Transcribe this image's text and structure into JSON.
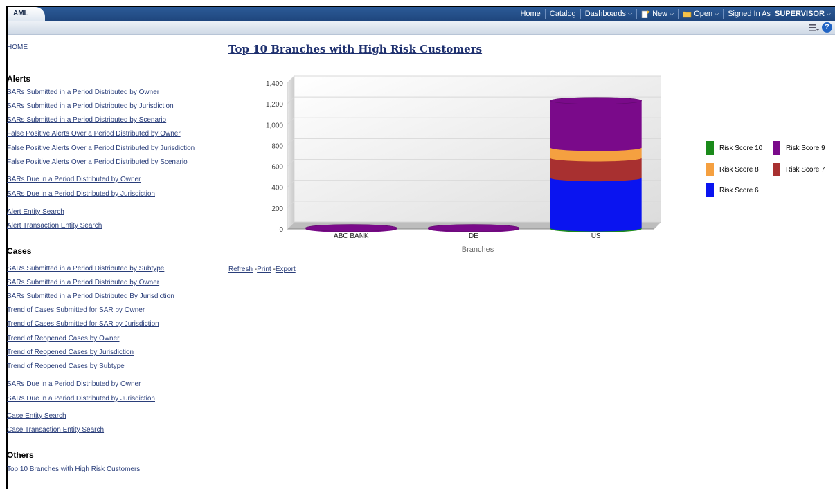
{
  "app": {
    "tab_label": "AML"
  },
  "nav": {
    "home": "Home",
    "catalog": "Catalog",
    "dashboards": "Dashboards",
    "new": "New",
    "open": "Open",
    "signed_in_prefix": "Signed In As",
    "user": "SUPERVISOR"
  },
  "sidebar": {
    "home_link": "HOME",
    "alerts_heading": "Alerts",
    "alerts": [
      "SARs Submitted in a Period Distributed by Owner",
      "SARs Submitted in a Period Distributed by Jurisdiction",
      "SARs Submitted in a Period Distributed by Scenario",
      "False Positive Alerts Over a Period Distributed by Owner",
      "False Positive Alerts Over a Period Distributed by Jurisdiction",
      "False Positive Alerts Over a Period Distributed by Scenario",
      "SARs Due in a Period Distributed by Owner",
      "SARs Due in a Period Distributed by Jurisdiction",
      "Alert Entity Search",
      "Alert Transaction Entity Search"
    ],
    "cases_heading": "Cases",
    "cases": [
      "SARs Submitted in a Period Distributed by Subtype",
      "SARs Submitted in a Period Distributed by Owner",
      "SARs Submitted in a Period Distributed By Jurisdiction",
      "Trend of Cases Submitted for SAR by Owner",
      "Trend of Cases Submitted for SAR by Jurisdiction",
      "Trend of Reopened Cases by Owner",
      "Trend of Reopened Cases by Jurisdiction",
      "Trend of Reopened Cases by Subtype",
      "SARs Due in a Period Distributed by Owner",
      "SARs Due in a Period Distributed by Jurisdiction",
      "Case Entity Search",
      "Case Transaction Entity Search"
    ],
    "others_heading": "Others",
    "others": [
      "Top 10 Branches with High Risk Customers"
    ]
  },
  "main": {
    "title": "Top 10 Branches with High Risk Customers",
    "refresh": "Refresh",
    "print": "Print",
    "export": "Export",
    "separator": "-"
  },
  "colors": {
    "header_blue": "#1f467d",
    "link": "#2a3e7a",
    "risk10": "#1a8a1a",
    "risk9": "#7a0a8a",
    "risk8": "#f5a040",
    "risk7": "#a83030",
    "risk6": "#0a14f0"
  },
  "chart_data": {
    "type": "bar",
    "stacked": true,
    "title": "",
    "xlabel": "Branches",
    "ylabel": "",
    "ylim": [
      0,
      1400
    ],
    "yticks": [
      "0",
      "200",
      "400",
      "600",
      "800",
      "1,000",
      "1,200",
      "1,400"
    ],
    "categories": [
      "ABC BANK",
      "DE",
      "US"
    ],
    "series": [
      {
        "name": "Risk Score 10",
        "values": [
          0,
          0,
          10
        ]
      },
      {
        "name": "Risk Score 6",
        "values": [
          0,
          0,
          480
        ]
      },
      {
        "name": "Risk Score 7",
        "values": [
          0,
          0,
          190
        ]
      },
      {
        "name": "Risk Score 8",
        "values": [
          0,
          0,
          100
        ]
      },
      {
        "name": "Risk Score 9",
        "values": [
          10,
          10,
          450
        ]
      }
    ],
    "legend": [
      "Risk Score 10",
      "Risk Score 9",
      "Risk Score 8",
      "Risk Score 7",
      "Risk Score 6"
    ],
    "legend_position": "right"
  }
}
